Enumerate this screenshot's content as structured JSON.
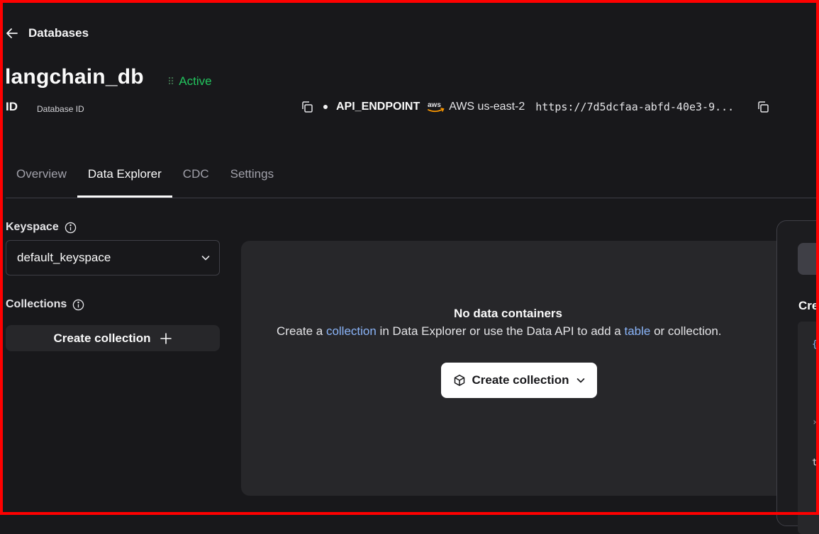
{
  "nav": {
    "back_label": "Databases"
  },
  "database": {
    "name": "langchain_db",
    "status": "Active",
    "id_label": "ID",
    "id_sublabel": "Database ID",
    "endpoint_label": "API_ENDPOINT",
    "provider_logo": "aws",
    "region": "AWS us-east-2",
    "endpoint_url": "https://7d5dcfaa-abfd-40e3-9..."
  },
  "tabs": [
    {
      "label": "Overview",
      "active": false
    },
    {
      "label": "Data Explorer",
      "active": true
    },
    {
      "label": "CDC",
      "active": false
    },
    {
      "label": "Settings",
      "active": false
    }
  ],
  "sidebar": {
    "keyspace_label": "Keyspace",
    "keyspace_value": "default_keyspace",
    "collections_label": "Collections",
    "create_collection_label": "Create collection"
  },
  "main": {
    "empty_title": "No data containers",
    "desc_1": "Create a ",
    "desc_link_1": "collection",
    "desc_2": " in Data Explorer or use the Data API to add a ",
    "desc_link_2": "table",
    "desc_3": " or collection.",
    "create_button_label": "Create collection"
  },
  "right_panel": {
    "heading": "Cre"
  },
  "colors": {
    "background": "#18181b",
    "panel": "#27272a",
    "active_status": "#22c55e",
    "link": "#8ab4f8",
    "frame_border": "#ff0000"
  },
  "icons": [
    "arrow-left-icon",
    "drag-handle-icon",
    "copy-icon",
    "aws-logo",
    "info-icon",
    "chevron-down-icon",
    "plus-icon",
    "cube-icon"
  ]
}
